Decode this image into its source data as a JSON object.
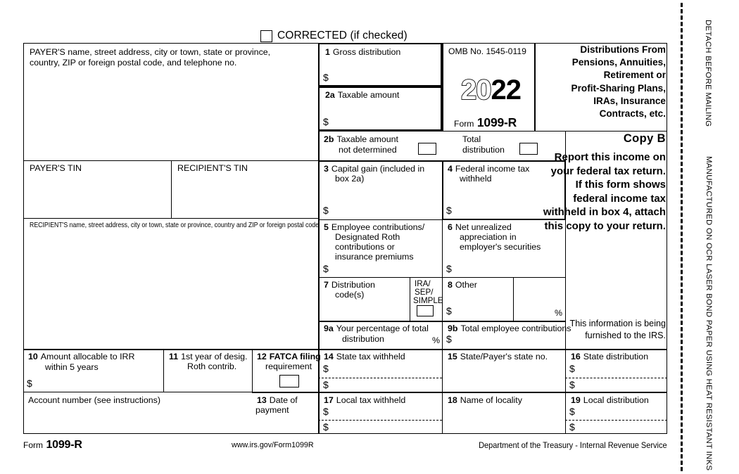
{
  "form": {
    "corrected_label": "CORRECTED (if checked)",
    "omb": "OMB No. 1545-0119",
    "year_hollow": "20",
    "year_solid": "22",
    "form_word": "Form",
    "form_number": "1099-R",
    "title_lines": [
      "Distributions From",
      "Pensions, Annuities,",
      "Retirement or",
      "Profit-Sharing Plans,",
      "IRAs, Insurance",
      "Contracts, etc."
    ],
    "copy_label": "Copy  B",
    "report_text": "Report this income on your federal tax return. If this form shows federal income tax withheld in box 4, attach this copy to your return.",
    "irs_note": "This information is being furnished to the IRS.",
    "footer_form_word": "Form",
    "footer_form_number": "1099-R",
    "footer_url": "www.irs.gov/Form1099R",
    "footer_department": "Department of the Treasury - Internal Revenue Service",
    "side_text_top": "DETACH BEFORE MAILING",
    "side_text_bottom": "MANUFACTURED ON OCR LASER BOND PAPER USING HEAT RESISTANT INKS"
  },
  "payer": {
    "name_line1": "PAYER'S name, street address, city or town, state or province,",
    "name_line2": "country, ZIP or foreign postal code, and telephone no.",
    "tin_label": "PAYER'S TIN"
  },
  "recipient": {
    "tin_label": "RECIPIENT'S TIN",
    "address_label": "RECIPIENT'S name, street address, city or town, state or province, country and ZIP or foreign postal code",
    "account_label": "Account number (see instructions)"
  },
  "boxes": {
    "b1": {
      "num": "1",
      "label": "Gross distribution",
      "dollar": "$"
    },
    "b2a": {
      "num": "2a",
      "label": "Taxable amount",
      "dollar": "$"
    },
    "b2b": {
      "num": "2b",
      "label_l1": "Taxable amount",
      "label_l2": "not determined"
    },
    "b2b_total": {
      "label_l1": "Total",
      "label_l2": "distribution"
    },
    "b3": {
      "num": "3",
      "label_l1": "Capital gain (included in",
      "label_l2": "box 2a)",
      "dollar": "$"
    },
    "b4": {
      "num": "4",
      "label_l1": "Federal income tax",
      "label_l2": "withheld",
      "dollar": "$"
    },
    "b5": {
      "num": "5",
      "label_l1": "Employee contributions/",
      "label_l2": "Designated Roth",
      "label_l3": "contributions or",
      "label_l4": "insurance premiums",
      "dollar": "$"
    },
    "b6": {
      "num": "6",
      "label_l1": "Net unrealized",
      "label_l2": "appreciation in",
      "label_l3": "employer's securities",
      "dollar": "$"
    },
    "b7": {
      "num": "7",
      "label_l1": "Distribution",
      "label_l2": "code(s)",
      "ira_l1": "IRA/",
      "ira_l2": "SEP/",
      "ira_l3": "SIMPLE"
    },
    "b8": {
      "num": "8",
      "label": "Other",
      "dollar": "$",
      "percent": "%"
    },
    "b9a": {
      "num": "9a",
      "label_l1": "Your percentage of total",
      "label_l2": "distribution",
      "percent": "%"
    },
    "b9b": {
      "num": "9b",
      "label": "Total employee contributions",
      "dollar": "$"
    },
    "b10": {
      "num": "10",
      "label_l1": "Amount allocable to IRR",
      "label_l2": "within 5 years",
      "dollar": "$"
    },
    "b11": {
      "num": "11",
      "label_l1": "1st year of desig.",
      "label_l2": "Roth contrib."
    },
    "b12": {
      "num": "12",
      "label_l1": "FATCA filing",
      "label_l2": "requirement"
    },
    "b13": {
      "num": "13",
      "label_l1": "Date of",
      "label_l2": "payment"
    },
    "b14": {
      "num": "14",
      "label": "State tax withheld",
      "dollar1": "$",
      "dollar2": "$"
    },
    "b15": {
      "num": "15",
      "label": "State/Payer's state no."
    },
    "b16": {
      "num": "16",
      "label": "State distribution",
      "dollar1": "$",
      "dollar2": "$"
    },
    "b17": {
      "num": "17",
      "label": "Local tax withheld",
      "dollar1": "$",
      "dollar2": "$"
    },
    "b18": {
      "num": "18",
      "label": "Name of locality"
    },
    "b19": {
      "num": "19",
      "label": "Local distribution",
      "dollar1": "$",
      "dollar2": "$"
    }
  }
}
